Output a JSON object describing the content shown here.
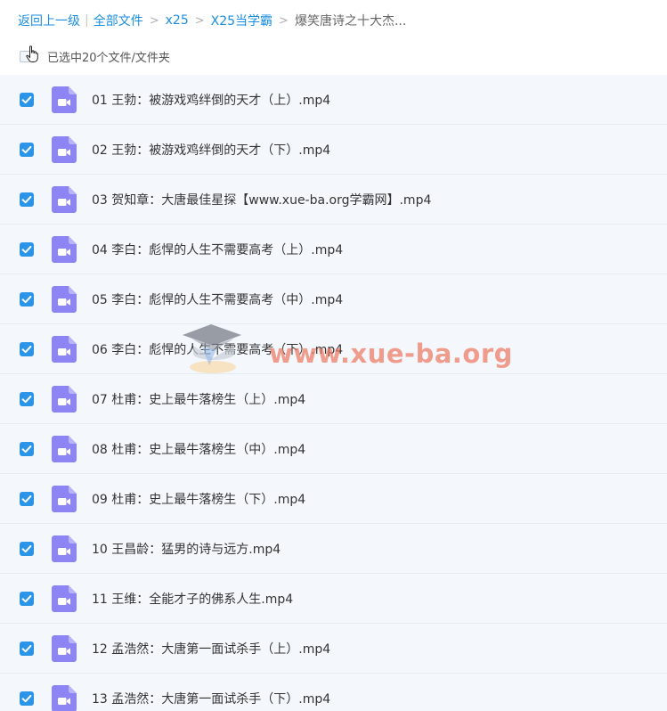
{
  "breadcrumb": {
    "back": "返回上一级",
    "all_files": "全部文件",
    "crumbs": [
      "x25",
      "X25当学霸"
    ],
    "current": "爆笑唐诗之十大杰..."
  },
  "selection": {
    "summary": "已选中20个文件/文件夹"
  },
  "icons": {
    "file_type": "video-file-icon",
    "checkbox": "checkbox-checked-icon",
    "cursor": "hand-pointer-icon"
  },
  "colors": {
    "link": "#1a8ee2",
    "checkbox": "#2b94e6",
    "video_icon": "#8d85f4",
    "row_selected_bg": "#f4f8fd"
  },
  "files": [
    {
      "name": "01 王勃：被游戏鸡绊倒的天才（上）.mp4",
      "checked": true
    },
    {
      "name": "02 王勃：被游戏鸡绊倒的天才（下）.mp4",
      "checked": true
    },
    {
      "name": "03 贺知章：大唐最佳星探【www.xue-ba.org学霸网】.mp4",
      "checked": true
    },
    {
      "name": "04 李白：彪悍的人生不需要高考（上）.mp4",
      "checked": true
    },
    {
      "name": "05 李白：彪悍的人生不需要高考（中）.mp4",
      "checked": true
    },
    {
      "name": "06 李白：彪悍的人生不需要高考（下）.mp4",
      "checked": true
    },
    {
      "name": "07 杜甫：史上最牛落榜生（上）.mp4",
      "checked": true
    },
    {
      "name": "08 杜甫：史上最牛落榜生（中）.mp4",
      "checked": true
    },
    {
      "name": "09 杜甫：史上最牛落榜生（下）.mp4",
      "checked": true
    },
    {
      "name": "10 王昌龄：猛男的诗与远方.mp4",
      "checked": true
    },
    {
      "name": "11 王维：全能才子的佛系人生.mp4",
      "checked": true
    },
    {
      "name": "12 孟浩然：大唐第一面试杀手（上）.mp4",
      "checked": true
    },
    {
      "name": "13 孟浩然：大唐第一面试杀手（下）.mp4",
      "checked": true
    }
  ],
  "watermark": {
    "text": "www.xue-ba.org"
  }
}
